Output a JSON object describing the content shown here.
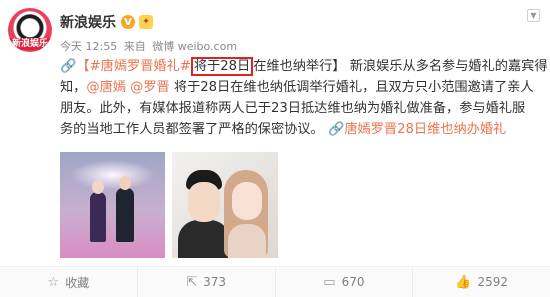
{
  "post": {
    "avatar_text": "新浪娱乐",
    "username": "新浪娱乐",
    "verified_badge": "V",
    "member_badge": "✦",
    "time": "今天 12:55",
    "source_prefix": "来自",
    "source": "微博 weibo.com",
    "line1_tag": "【#唐嫣罗晋婚礼#",
    "line1_highlight": "将于28日",
    "line1_after_highlight": "在维也纳举行】",
    "line1_rest": "新浪娱乐从多名参与婚礼的嘉宾得",
    "line2_start": "知，",
    "mention1": "@唐嫣",
    "mention2": "@罗晋",
    "line2_rest": " 将于28日在维也纳低调举行婚礼，且双方只小范围邀请了亲人",
    "line3": "朋友。此外，有媒体报道称两人已于23日抵达维也纳为婚礼做准备，参与婚礼服",
    "line4_text": "务的当地工作人员都签署了严格的保密协议。",
    "line4_link": "唐嫣罗晋28日维也纳办婚礼"
  },
  "actions": {
    "favorite": "收藏",
    "forward": "373",
    "comment": "670",
    "like": "2592"
  },
  "icons": {
    "favorite": "star-outline-icon",
    "forward": "forward-icon",
    "comment": "comment-icon",
    "like": "thumbs-up-icon",
    "link": "link-icon",
    "more": "chevron-down-icon"
  },
  "colors": {
    "link": "#eb7350",
    "highlight_box": "#e02424",
    "meta_text": "#8a8a8a"
  }
}
